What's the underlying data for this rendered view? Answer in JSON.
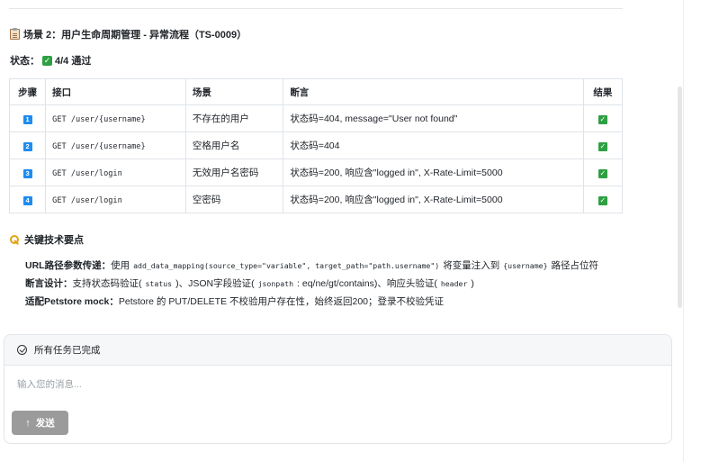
{
  "scenario": {
    "title": "场景 2：用户生命周期管理 - 异常流程（TS-0009）",
    "status_label": "状态：",
    "status_value": "4/4 通过"
  },
  "table": {
    "headers": [
      "步骤",
      "接口",
      "场景",
      "断言",
      "结果"
    ],
    "rows": [
      {
        "step": "1",
        "api": "GET /user/{username}",
        "scene": "不存在的用户",
        "assertion": "状态码=404, message=\"User not found\"",
        "result": "passed"
      },
      {
        "step": "2",
        "api": "GET /user/{username}",
        "scene": "空格用户名",
        "assertion": "状态码=404",
        "result": "passed"
      },
      {
        "step": "3",
        "api": "GET /user/login",
        "scene": "无效用户名密码",
        "assertion": "状态码=200, 响应含\"logged in\", X-Rate-Limit=5000",
        "result": "passed"
      },
      {
        "step": "4",
        "api": "GET /user/login",
        "scene": "空密码",
        "assertion": "状态码=200, 响应含\"logged in\", X-Rate-Limit=5000",
        "result": "passed"
      }
    ]
  },
  "key_points": {
    "heading": "关键技术要点",
    "items": [
      {
        "label": "URL路径参数传递：",
        "text1": "使用",
        "code1": "add_data_mapping(source_type=\"variable\", target_path=\"path.username\")",
        "text2": "将变量注入到",
        "code2": "{username}",
        "text3": "路径占位符"
      },
      {
        "label": "断言设计：",
        "text1": "支持状态码验证(",
        "code1": "status",
        "text2": ")、JSON字段验证(",
        "code2": "jsonpath",
        "text3": ": eq/ne/gt/contains)、响应头验证(",
        "code3": "header",
        "text4": ")"
      },
      {
        "label": "适配Petstore mock：",
        "text1": "Petstore 的 PUT/DELETE 不校验用户存在性，始终返回200；登录不校验凭证"
      }
    ]
  },
  "chat": {
    "header": "所有任务已完成",
    "input_placeholder": "输入您的消息...",
    "input_value": "",
    "send_label": "发送"
  },
  "icons": {
    "scenario": "clipboard-icon",
    "status": "check-box-icon",
    "key_points": "key-icon",
    "chat_header": "circle-check-icon",
    "send": "arrow-up-icon"
  },
  "colors": {
    "success": "#2ea043",
    "step_badge": "#1d8cf0",
    "send_button": "#9b9b9b",
    "key_icon": "#e3a316"
  }
}
